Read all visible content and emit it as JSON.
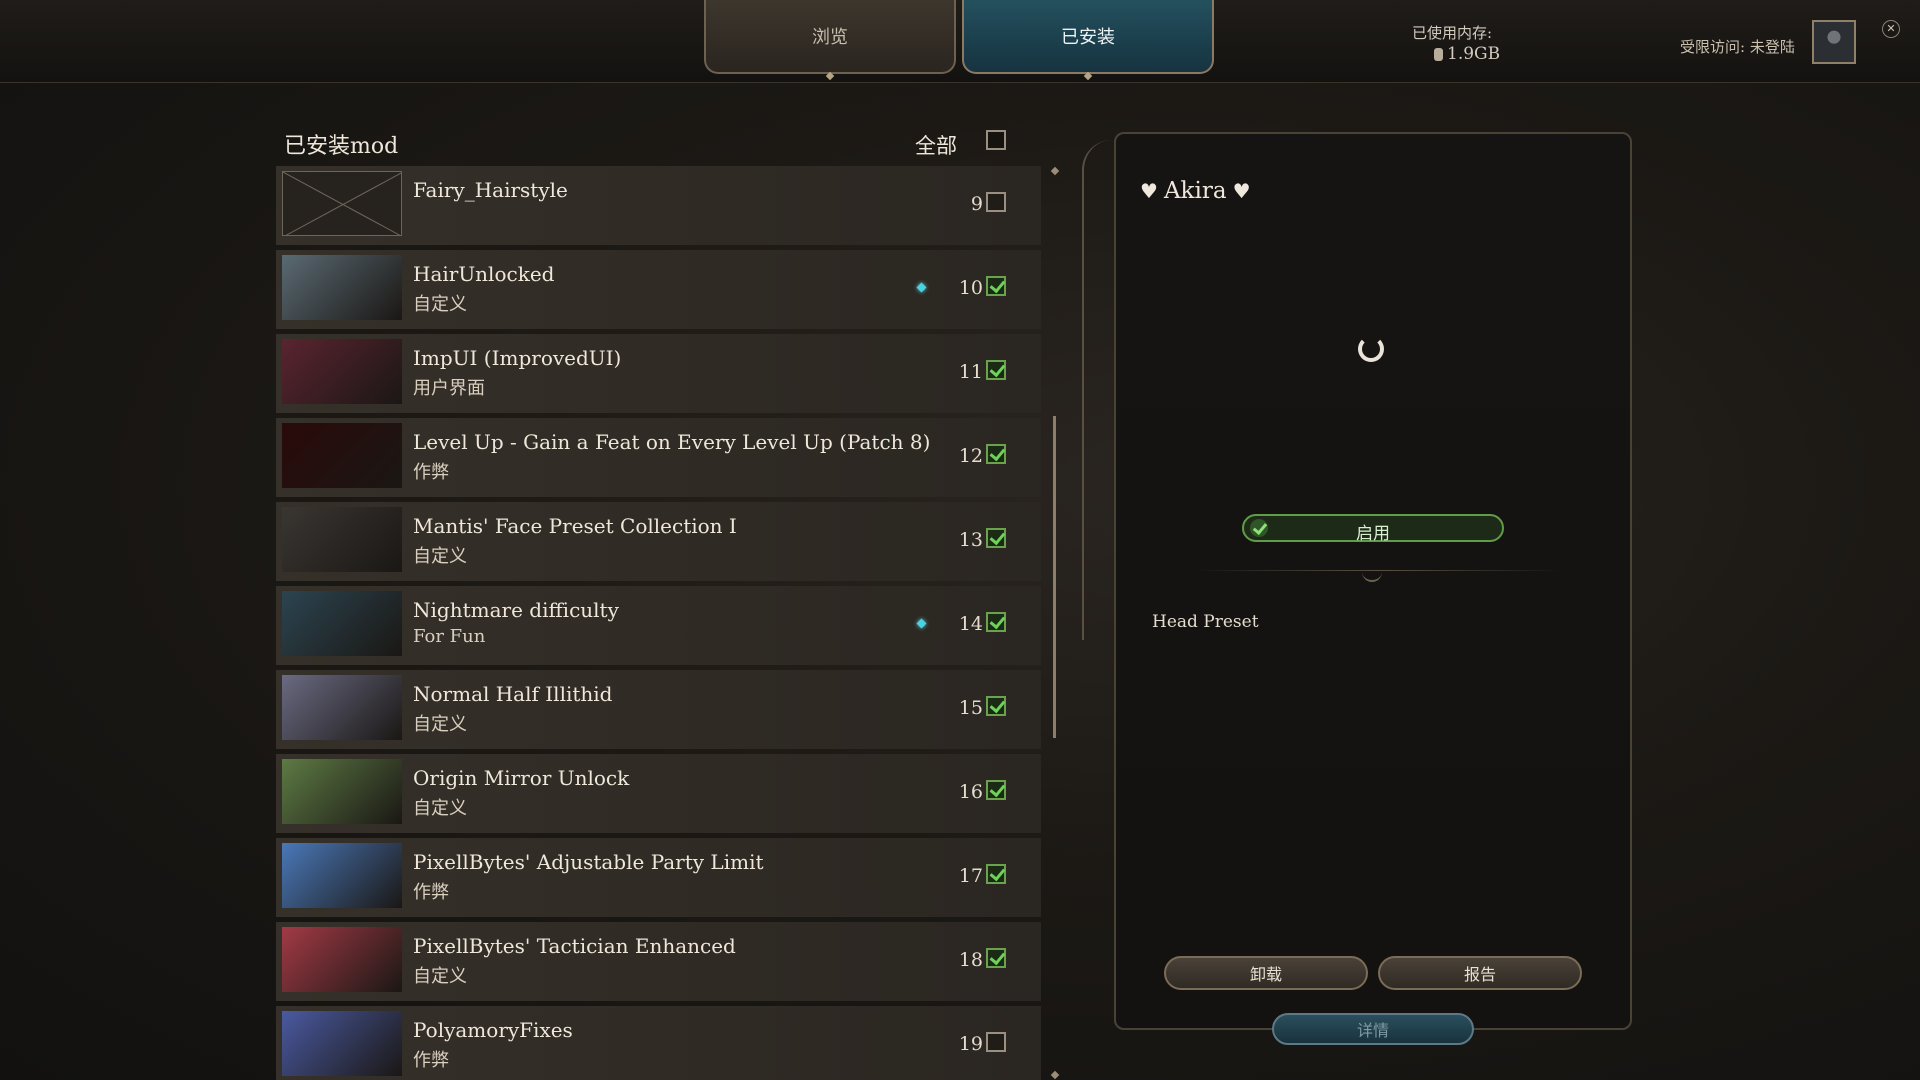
{
  "header": {
    "tabs": [
      {
        "label": "浏览",
        "active": false
      },
      {
        "label": "已安装",
        "active": true
      }
    ],
    "memory_label": "已使用内存:",
    "memory_value": "1.9GB",
    "access_text": "受限访问: 未登陆",
    "close_icon": "✕"
  },
  "list": {
    "title": "已安装mod",
    "all_label": "全部",
    "all_checked": false,
    "rows": [
      {
        "title": "Fairy_Hairstyle",
        "subtitle": "",
        "num": "9",
        "checked": false,
        "dot": false,
        "thumb": "empty"
      },
      {
        "title": "HairUnlocked",
        "subtitle": "自定义",
        "num": "10",
        "checked": true,
        "dot": true,
        "thumb": "#5a6a73"
      },
      {
        "title": "ImpUI (ImprovedUI)",
        "subtitle": "用户界面",
        "num": "11",
        "checked": true,
        "dot": false,
        "thumb": "#5a2430"
      },
      {
        "title": "Level Up - Gain a Feat on Every Level Up (Patch 8)",
        "subtitle": "作弊",
        "num": "12",
        "checked": true,
        "dot": false,
        "thumb": "#2a0a0a"
      },
      {
        "title": "Mantis' Face Preset Collection I",
        "subtitle": "自定义",
        "num": "13",
        "checked": true,
        "dot": false,
        "thumb": "#3a3632"
      },
      {
        "title": "Nightmare difficulty",
        "subtitle": "For Fun",
        "num": "14",
        "checked": true,
        "dot": true,
        "thumb": "#2c4450"
      },
      {
        "title": "Normal Half Illithid",
        "subtitle": "自定义",
        "num": "15",
        "checked": true,
        "dot": false,
        "thumb": "#6a6a82"
      },
      {
        "title": "Origin Mirror Unlock",
        "subtitle": "自定义",
        "num": "16",
        "checked": true,
        "dot": false,
        "thumb": "#5d7a44"
      },
      {
        "title": "PixellBytes' Adjustable Party Limit",
        "subtitle": "作弊",
        "num": "17",
        "checked": true,
        "dot": false,
        "thumb": "#4a78b8"
      },
      {
        "title": "PixellBytes' Tactician Enhanced",
        "subtitle": "自定义",
        "num": "18",
        "checked": true,
        "dot": false,
        "thumb": "#a23a46"
      },
      {
        "title": "PolyamoryFixes",
        "subtitle": "作弊",
        "num": "19",
        "checked": false,
        "dot": false,
        "thumb": "#4a5aa0"
      }
    ]
  },
  "detail": {
    "heart_icon": "♥",
    "name": "Akira",
    "enable_label": "启用",
    "preset": "Head Preset",
    "uninstall_label": "卸载",
    "report_label": "报告",
    "details_label": "详情"
  },
  "colors": {
    "accent_teal": "#24505e",
    "check_green": "#6fd15a",
    "dot_cyan": "#4fd0e0"
  }
}
